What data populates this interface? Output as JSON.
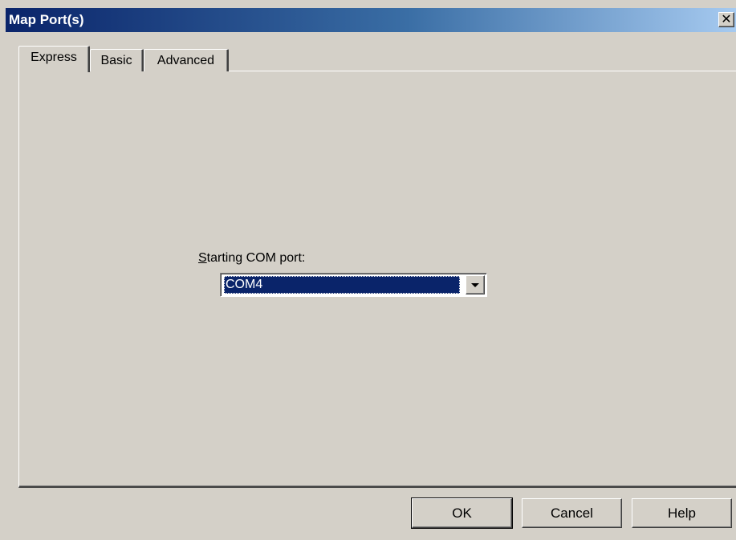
{
  "window": {
    "title": "Map Port(s)",
    "close_glyph": "✕"
  },
  "tabs": [
    {
      "label": "Express",
      "active": true
    },
    {
      "label": "Basic",
      "active": false
    },
    {
      "label": "Advanced",
      "active": false
    }
  ],
  "express": {
    "starting_port_label_access_key": "S",
    "starting_port_label_rest": "tarting COM port:",
    "starting_port_value": "COM4"
  },
  "buttons": {
    "ok": "OK",
    "cancel": "Cancel",
    "help": "Help"
  },
  "colors": {
    "titlebar_start": "#0a246a",
    "titlebar_end": "#a6caf0",
    "face": "#d4d0c8",
    "selection": "#0a246a"
  },
  "icons": {
    "close": "close-icon",
    "dropdown": "chevron-down-icon"
  }
}
